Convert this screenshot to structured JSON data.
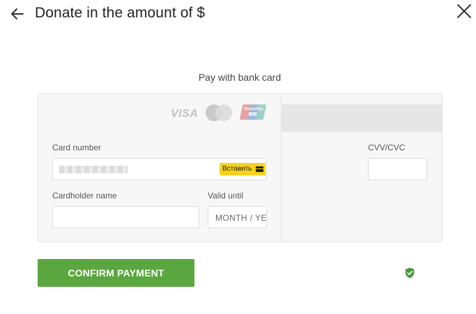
{
  "header": {
    "title": "Donate in the amount of $",
    "back_icon": "arrow-left-icon",
    "close_icon": "close-icon"
  },
  "subtitle": "Pay with bank card",
  "card_logos": [
    "VISA",
    "MasterCard",
    "UnionPay"
  ],
  "form": {
    "card_number_label": "Card number",
    "paste_button_label": "Вставить",
    "cardholder_label": "Cardholder name",
    "valid_until_label": "Valid until",
    "valid_until_placeholder": "MONTH / YEAR",
    "cvv_label": "CVV/CVC"
  },
  "confirm_button_label": "CONFIRM PAYMENT",
  "security_icon": "shield-check-icon",
  "colors": {
    "confirm": "#5ba73f",
    "paste": "#f7d21c",
    "panel": "#f7f7f7"
  }
}
